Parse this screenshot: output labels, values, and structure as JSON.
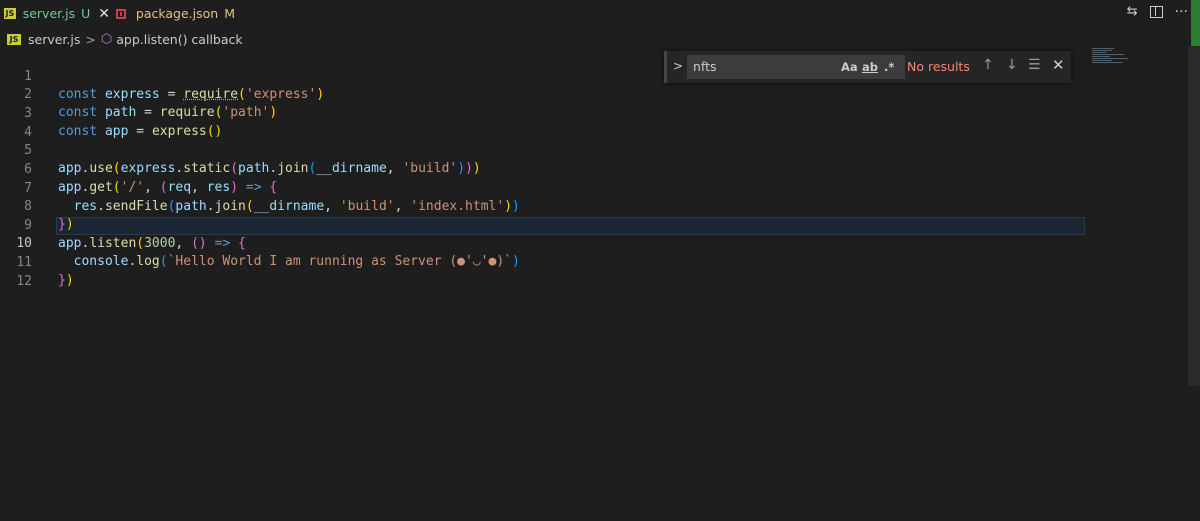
{
  "tabs": [
    {
      "icon": "JS",
      "label": "server.js",
      "status": "U",
      "close": "✕"
    },
    {
      "icon": "npm",
      "label": "package.json",
      "status": "M"
    }
  ],
  "toolbar": {
    "compare_icon": "compare-icon",
    "split_icon": "split-editor-icon",
    "more": "···"
  },
  "breadcrumb": {
    "icon": "JS",
    "file": "server.js",
    "separator": ">",
    "symbol": "app.listen() callback"
  },
  "find": {
    "value": "nfts",
    "match_case": "Aa",
    "whole_word": "ab",
    "regex": ".*",
    "result": "No results",
    "up": "↑",
    "down": "↓",
    "close": "✕"
  },
  "editor": {
    "active_line": 10,
    "line_numbers": [
      "1",
      "2",
      "3",
      "4",
      "5",
      "6",
      "7",
      "8",
      "9",
      "10",
      "11",
      "12"
    ]
  },
  "colors": {
    "background": "#1e1e1e",
    "keyword": "#569cd6",
    "string": "#ce9178",
    "function": "#dcdcaa",
    "untracked": "#73c991",
    "modified": "#e2c08d",
    "error": "#f48771"
  }
}
